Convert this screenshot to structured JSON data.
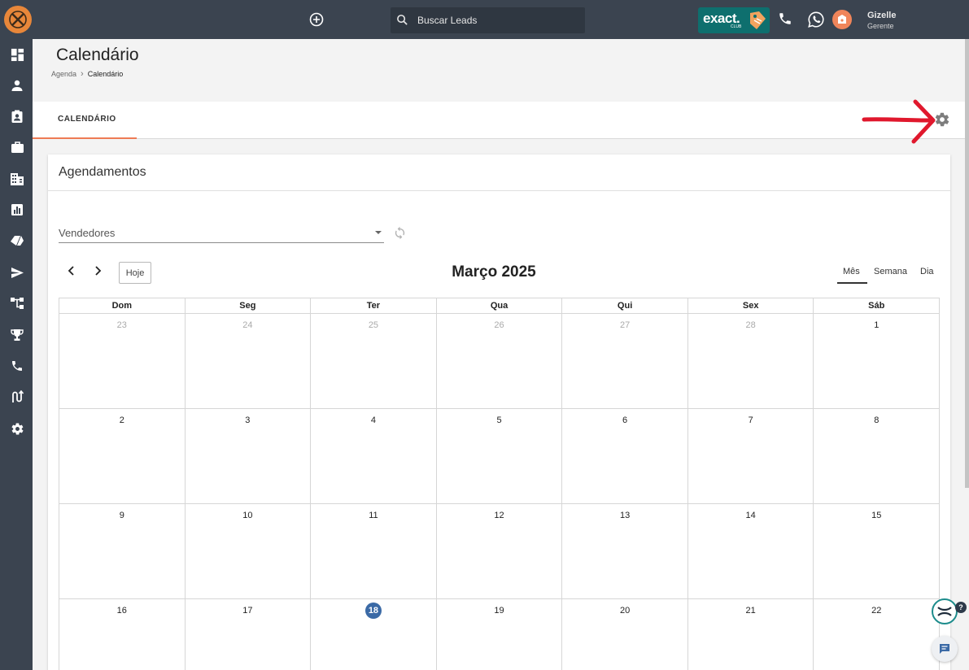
{
  "topbar": {
    "search_placeholder": "Buscar Leads",
    "brand_badge": {
      "word": "exact.",
      "sub": "CLUB"
    },
    "user": {
      "name": "Gizelle",
      "role": "Gerente"
    }
  },
  "sidebar": {
    "items": [
      "dashboard-icon",
      "person-icon",
      "contact-card-icon",
      "briefcase-icon",
      "building-icon",
      "bar-chart-icon",
      "tags-icon",
      "send-icon",
      "flow-icon",
      "trophy-icon",
      "phone-icon",
      "route-icon",
      "settings-icon"
    ]
  },
  "header": {
    "title": "Calendário",
    "breadcrumb": [
      "Agenda",
      "Calendário"
    ]
  },
  "tabs": [
    {
      "label": "CALENDÁRIO",
      "active": true
    }
  ],
  "card": {
    "title": "Agendamentos",
    "filter_placeholder": "Vendedores"
  },
  "calendar": {
    "today_label": "Hoje",
    "month_title": "Março 2025",
    "views": [
      "Mês",
      "Semana",
      "Dia"
    ],
    "active_view": "Mês",
    "weekdays": [
      "Dom",
      "Seg",
      "Ter",
      "Qua",
      "Qui",
      "Sex",
      "Sáb"
    ],
    "weeks": [
      [
        {
          "d": "23",
          "other": true
        },
        {
          "d": "24",
          "other": true
        },
        {
          "d": "25",
          "other": true
        },
        {
          "d": "26",
          "other": true
        },
        {
          "d": "27",
          "other": true
        },
        {
          "d": "28",
          "other": true
        },
        {
          "d": "1"
        }
      ],
      [
        {
          "d": "2"
        },
        {
          "d": "3"
        },
        {
          "d": "4"
        },
        {
          "d": "5"
        },
        {
          "d": "6"
        },
        {
          "d": "7"
        },
        {
          "d": "8"
        }
      ],
      [
        {
          "d": "9"
        },
        {
          "d": "10"
        },
        {
          "d": "11"
        },
        {
          "d": "12"
        },
        {
          "d": "13"
        },
        {
          "d": "14"
        },
        {
          "d": "15"
        }
      ],
      [
        {
          "d": "16"
        },
        {
          "d": "17"
        },
        {
          "d": "18",
          "today": true
        },
        {
          "d": "19"
        },
        {
          "d": "20"
        },
        {
          "d": "21"
        },
        {
          "d": "22"
        }
      ]
    ]
  },
  "colors": {
    "topbar": "#3b4450",
    "accent": "#ee7b55",
    "today": "#3b6aa6",
    "annotation_arrow": "#e0182d"
  },
  "widgets": {
    "help_badge": "?"
  }
}
